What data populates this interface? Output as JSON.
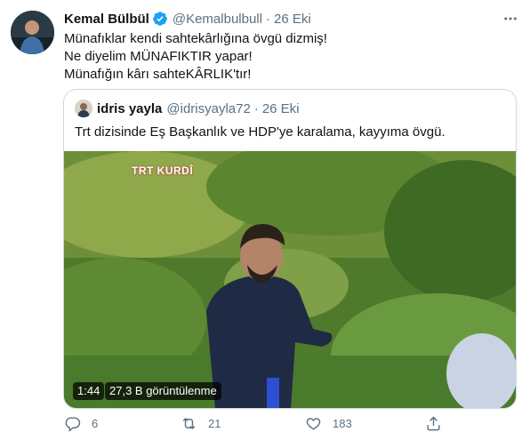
{
  "tweet": {
    "author_name": "Kemal Bülbül",
    "author_handle": "@Kemalbulbull",
    "separator": "·",
    "date": "26 Eki",
    "lines": [
      "Münafıklar kendi sahtekârlığına övgü dizmiş!",
      "Ne diyelim MÜNAFIKTIR yapar!",
      "Münafığın kârı sahteKÂRLIK'tır!"
    ]
  },
  "quoted": {
    "author_name": "idris yayla",
    "author_handle": "@idrisyayla72",
    "separator": "·",
    "date": "26 Eki",
    "text": "Trt dizisinde Eş Başkanlık ve HDP'ye karalama, kayyıma övgü.",
    "media": {
      "channel_logo": "TRT KURDÎ",
      "duration": "1:44",
      "views": "27,3 B görüntülenme"
    }
  },
  "actions": {
    "reply_count": "6",
    "retweet_count": "21",
    "like_count": "183",
    "reply_icon": "reply-icon",
    "retweet_icon": "retweet-icon",
    "like_icon": "heart-icon",
    "share_icon": "share-icon"
  },
  "colors": {
    "text_primary": "#0f1419",
    "text_secondary": "#5b7083",
    "verified": "#1da1f2",
    "border": "#cfd9de"
  }
}
